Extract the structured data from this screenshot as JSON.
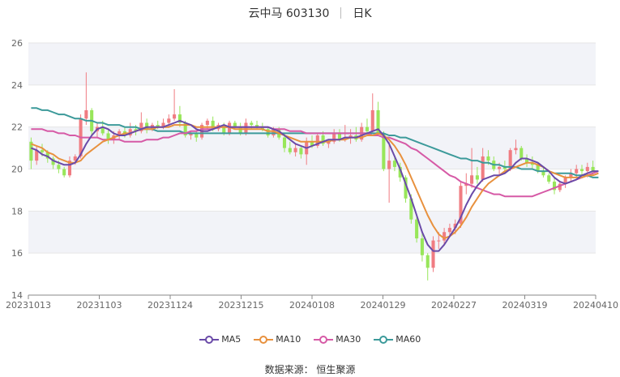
{
  "title": {
    "name": "云中马 603130",
    "period": "日K"
  },
  "source": "数据来源： 恒生聚源",
  "colors": {
    "up": "#f07c82",
    "down": "#98e65a",
    "ma5": "#6a4aa8",
    "ma10": "#e8913e",
    "ma30": "#d65aa6",
    "ma60": "#3c9a9a",
    "band": "#f2f3f8"
  },
  "chart_data": {
    "type": "candlestick",
    "ylim": [
      14,
      26
    ],
    "yticks": [
      14,
      16,
      18,
      20,
      22,
      24,
      26
    ],
    "xtick_labels": [
      "20231013",
      "20231103",
      "20231124",
      "20231215",
      "20240108",
      "20240129",
      "20240227",
      "20240319",
      "20240410"
    ],
    "legend": [
      "MA5",
      "MA10",
      "MA30",
      "MA60"
    ],
    "ohlc": [
      [
        21.3,
        21.5,
        20.0,
        20.4
      ],
      [
        20.4,
        21.1,
        20.2,
        20.9
      ],
      [
        20.9,
        21.2,
        20.6,
        20.8
      ],
      [
        20.8,
        20.9,
        20.3,
        20.5
      ],
      [
        20.5,
        20.6,
        20.0,
        20.2
      ],
      [
        20.2,
        20.4,
        19.8,
        20.0
      ],
      [
        20.0,
        20.1,
        19.6,
        19.7
      ],
      [
        19.7,
        20.6,
        19.6,
        20.4
      ],
      [
        20.4,
        20.7,
        20.2,
        20.6
      ],
      [
        20.6,
        22.6,
        20.5,
        22.4
      ],
      [
        22.4,
        24.6,
        22.1,
        22.8
      ],
      [
        22.8,
        22.9,
        21.6,
        21.8
      ],
      [
        21.8,
        22.2,
        21.5,
        22.0
      ],
      [
        22.0,
        22.3,
        21.6,
        21.7
      ],
      [
        21.7,
        21.9,
        21.2,
        21.4
      ],
      [
        21.4,
        21.8,
        21.2,
        21.6
      ],
      [
        21.6,
        21.9,
        21.4,
        21.8
      ],
      [
        21.8,
        22.0,
        21.5,
        21.6
      ],
      [
        21.6,
        22.2,
        21.5,
        21.9
      ],
      [
        21.9,
        22.1,
        21.6,
        21.8
      ],
      [
        21.8,
        22.7,
        21.7,
        22.2
      ],
      [
        22.2,
        22.4,
        21.7,
        21.9
      ],
      [
        21.9,
        22.2,
        21.8,
        22.1
      ],
      [
        22.1,
        22.3,
        21.9,
        22.0
      ],
      [
        22.0,
        22.4,
        21.9,
        22.2
      ],
      [
        22.2,
        22.6,
        22.0,
        22.4
      ],
      [
        22.4,
        23.8,
        22.3,
        22.6
      ],
      [
        22.6,
        23.0,
        22.0,
        22.2
      ],
      [
        22.2,
        22.3,
        21.5,
        21.6
      ],
      [
        21.6,
        21.8,
        21.4,
        21.7
      ],
      [
        21.7,
        21.8,
        21.3,
        21.5
      ],
      [
        21.5,
        22.2,
        21.4,
        22.1
      ],
      [
        22.1,
        22.4,
        21.9,
        22.3
      ],
      [
        22.3,
        22.5,
        21.8,
        21.9
      ],
      [
        21.9,
        22.2,
        21.8,
        22.1
      ],
      [
        22.1,
        22.2,
        21.6,
        21.7
      ],
      [
        21.7,
        22.3,
        21.6,
        22.2
      ],
      [
        22.2,
        22.3,
        21.9,
        22.0
      ],
      [
        22.0,
        22.2,
        21.6,
        21.7
      ],
      [
        21.7,
        22.4,
        21.6,
        22.2
      ],
      [
        22.2,
        22.3,
        21.9,
        22.1
      ],
      [
        22.1,
        22.3,
        21.9,
        22.0
      ],
      [
        22.0,
        22.2,
        21.8,
        21.9
      ],
      [
        21.9,
        22.0,
        21.5,
        21.6
      ],
      [
        21.6,
        22.0,
        21.5,
        21.9
      ],
      [
        21.9,
        22.0,
        21.4,
        21.5
      ],
      [
        21.5,
        21.7,
        20.8,
        21.0
      ],
      [
        21.0,
        21.3,
        20.7,
        20.8
      ],
      [
        20.8,
        21.2,
        20.6,
        21.0
      ],
      [
        21.0,
        21.1,
        20.5,
        20.7
      ],
      [
        20.7,
        21.5,
        20.2,
        21.3
      ],
      [
        21.3,
        21.6,
        21.0,
        21.1
      ],
      [
        21.1,
        21.7,
        21.0,
        21.6
      ],
      [
        21.6,
        21.8,
        21.1,
        21.2
      ],
      [
        21.2,
        21.4,
        21.0,
        21.3
      ],
      [
        21.3,
        21.9,
        21.2,
        21.7
      ],
      [
        21.7,
        21.9,
        21.3,
        21.4
      ],
      [
        21.4,
        22.1,
        21.3,
        21.5
      ],
      [
        21.5,
        21.9,
        21.2,
        21.6
      ],
      [
        21.6,
        22.0,
        21.3,
        21.4
      ],
      [
        21.4,
        22.2,
        21.3,
        22.0
      ],
      [
        22.0,
        22.4,
        21.6,
        21.8
      ],
      [
        21.8,
        23.6,
        21.7,
        22.8
      ],
      [
        22.8,
        23.2,
        21.6,
        21.7
      ],
      [
        21.7,
        21.8,
        19.9,
        20.0
      ],
      [
        20.0,
        21.3,
        18.4,
        20.4
      ],
      [
        20.4,
        20.6,
        19.9,
        20.1
      ],
      [
        20.1,
        20.3,
        19.4,
        19.6
      ],
      [
        19.6,
        19.7,
        18.4,
        18.6
      ],
      [
        18.6,
        18.8,
        17.4,
        17.6
      ],
      [
        17.6,
        17.8,
        16.5,
        16.7
      ],
      [
        16.7,
        17.0,
        15.6,
        15.9
      ],
      [
        15.9,
        16.0,
        14.7,
        15.3
      ],
      [
        15.3,
        16.8,
        15.1,
        16.6
      ],
      [
        16.6,
        17.0,
        16.2,
        16.6
      ],
      [
        16.6,
        17.2,
        16.4,
        17.0
      ],
      [
        17.0,
        17.4,
        16.8,
        17.2
      ],
      [
        17.2,
        17.6,
        16.9,
        17.4
      ],
      [
        17.4,
        19.4,
        17.2,
        19.2
      ],
      [
        19.2,
        19.8,
        18.8,
        19.3
      ],
      [
        19.3,
        21.0,
        19.1,
        19.7
      ],
      [
        19.7,
        20.1,
        19.3,
        19.5
      ],
      [
        19.5,
        21.0,
        19.4,
        20.6
      ],
      [
        20.6,
        20.9,
        20.2,
        20.4
      ],
      [
        20.4,
        20.6,
        19.9,
        20.0
      ],
      [
        20.0,
        20.3,
        19.7,
        20.1
      ],
      [
        20.1,
        20.4,
        19.8,
        20.0
      ],
      [
        20.0,
        21.0,
        19.9,
        20.9
      ],
      [
        20.9,
        21.4,
        20.7,
        21.0
      ],
      [
        21.0,
        21.1,
        20.4,
        20.5
      ],
      [
        20.5,
        20.7,
        20.1,
        20.3
      ],
      [
        20.3,
        20.6,
        20.0,
        20.2
      ],
      [
        20.2,
        20.3,
        19.8,
        19.9
      ],
      [
        19.9,
        20.1,
        19.6,
        19.7
      ],
      [
        19.7,
        19.8,
        19.3,
        19.4
      ],
      [
        19.4,
        19.6,
        18.8,
        19.0
      ],
      [
        19.0,
        19.4,
        18.9,
        19.3
      ],
      [
        19.3,
        19.7,
        19.1,
        19.6
      ],
      [
        19.6,
        20.0,
        19.4,
        19.8
      ],
      [
        19.8,
        20.2,
        19.6,
        20.0
      ],
      [
        20.0,
        20.2,
        19.7,
        19.9
      ],
      [
        19.9,
        20.3,
        19.6,
        20.1
      ],
      [
        20.1,
        20.4,
        19.7,
        19.9
      ]
    ],
    "ma5": [
      21.0,
      20.9,
      20.7,
      20.6,
      20.4,
      20.3,
      20.2,
      20.2,
      20.3,
      20.7,
      21.2,
      21.6,
      21.9,
      22.0,
      21.9,
      21.7,
      21.6,
      21.6,
      21.7,
      21.8,
      21.9,
      22.0,
      22.0,
      22.0,
      22.0,
      22.1,
      22.2,
      22.3,
      22.2,
      22.1,
      21.9,
      21.8,
      21.8,
      21.9,
      22.0,
      22.1,
      22.0,
      22.0,
      22.0,
      22.0,
      22.0,
      22.0,
      22.0,
      22.0,
      21.9,
      21.8,
      21.6,
      21.4,
      21.2,
      21.1,
      21.0,
      21.1,
      21.2,
      21.3,
      21.4,
      21.4,
      21.4,
      21.5,
      21.5,
      21.5,
      21.6,
      21.7,
      21.8,
      21.9,
      21.6,
      21.2,
      20.6,
      20.0,
      19.3,
      18.6,
      17.8,
      17.0,
      16.4,
      16.1,
      16.1,
      16.4,
      16.8,
      17.2,
      17.7,
      18.3,
      18.8,
      19.2,
      19.5,
      19.6,
      19.7,
      19.7,
      19.8,
      20.0,
      20.3,
      20.5,
      20.5,
      20.4,
      20.3,
      20.1,
      19.9,
      19.6,
      19.4,
      19.3,
      19.4,
      19.5,
      19.7,
      19.8,
      19.9,
      19.9
    ],
    "ma10": [
      21.2,
      21.1,
      21.0,
      20.8,
      20.7,
      20.5,
      20.4,
      20.3,
      20.3,
      20.4,
      20.7,
      20.9,
      21.1,
      21.3,
      21.4,
      21.5,
      21.6,
      21.7,
      21.7,
      21.8,
      21.9,
      21.9,
      21.9,
      22.0,
      22.0,
      22.0,
      22.1,
      22.1,
      22.1,
      22.1,
      22.0,
      22.0,
      22.0,
      22.0,
      22.0,
      22.0,
      22.0,
      21.9,
      21.9,
      21.9,
      21.9,
      21.9,
      21.9,
      21.8,
      21.8,
      21.7,
      21.6,
      21.5,
      21.4,
      21.3,
      21.3,
      21.3,
      21.3,
      21.3,
      21.3,
      21.4,
      21.4,
      21.4,
      21.5,
      21.5,
      21.5,
      21.6,
      21.6,
      21.7,
      21.6,
      21.4,
      21.1,
      20.7,
      20.2,
      19.6,
      19.0,
      18.4,
      17.8,
      17.3,
      16.9,
      16.7,
      16.8,
      17.0,
      17.3,
      17.7,
      18.2,
      18.6,
      19.0,
      19.3,
      19.5,
      19.7,
      19.9,
      20.0,
      20.1,
      20.2,
      20.3,
      20.3,
      20.2,
      20.1,
      19.9,
      19.8,
      19.7,
      19.6,
      19.6,
      19.6,
      19.6,
      19.7,
      19.7,
      19.8
    ],
    "ma30": [
      21.9,
      21.9,
      21.9,
      21.8,
      21.8,
      21.7,
      21.7,
      21.6,
      21.6,
      21.5,
      21.5,
      21.5,
      21.5,
      21.4,
      21.4,
      21.4,
      21.4,
      21.3,
      21.3,
      21.3,
      21.3,
      21.4,
      21.4,
      21.4,
      21.5,
      21.5,
      21.6,
      21.7,
      21.7,
      21.8,
      21.8,
      21.9,
      21.9,
      21.9,
      22.0,
      22.0,
      22.0,
      22.0,
      22.0,
      22.0,
      22.0,
      22.0,
      22.0,
      22.0,
      21.9,
      21.9,
      21.9,
      21.8,
      21.8,
      21.8,
      21.7,
      21.7,
      21.7,
      21.7,
      21.7,
      21.7,
      21.7,
      21.7,
      21.7,
      21.7,
      21.7,
      21.7,
      21.6,
      21.6,
      21.5,
      21.5,
      21.4,
      21.3,
      21.2,
      21.0,
      20.9,
      20.7,
      20.5,
      20.3,
      20.1,
      19.9,
      19.7,
      19.6,
      19.4,
      19.3,
      19.2,
      19.1,
      19.0,
      18.9,
      18.8,
      18.8,
      18.7,
      18.7,
      18.7,
      18.7,
      18.7,
      18.7,
      18.8,
      18.9,
      19.0,
      19.1,
      19.2,
      19.3,
      19.4,
      19.5,
      19.6,
      19.7,
      19.8,
      19.9
    ],
    "ma60": [
      22.9,
      22.9,
      22.8,
      22.8,
      22.7,
      22.6,
      22.6,
      22.5,
      22.4,
      22.4,
      22.3,
      22.3,
      22.2,
      22.2,
      22.1,
      22.1,
      22.1,
      22.0,
      22.0,
      22.0,
      21.9,
      21.9,
      21.9,
      21.8,
      21.8,
      21.8,
      21.8,
      21.8,
      21.7,
      21.7,
      21.7,
      21.7,
      21.7,
      21.7,
      21.7,
      21.7,
      21.7,
      21.7,
      21.7,
      21.7,
      21.7,
      21.7,
      21.7,
      21.7,
      21.7,
      21.7,
      21.7,
      21.7,
      21.7,
      21.7,
      21.7,
      21.7,
      21.7,
      21.7,
      21.7,
      21.7,
      21.7,
      21.7,
      21.7,
      21.7,
      21.7,
      21.7,
      21.7,
      21.7,
      21.7,
      21.6,
      21.6,
      21.5,
      21.5,
      21.4,
      21.3,
      21.2,
      21.1,
      21.0,
      20.9,
      20.8,
      20.7,
      20.6,
      20.5,
      20.5,
      20.4,
      20.4,
      20.3,
      20.3,
      20.2,
      20.2,
      20.1,
      20.1,
      20.1,
      20.0,
      20.0,
      20.0,
      19.9,
      19.9,
      19.9,
      19.8,
      19.8,
      19.8,
      19.8,
      19.7,
      19.7,
      19.7,
      19.6,
      19.6
    ]
  }
}
